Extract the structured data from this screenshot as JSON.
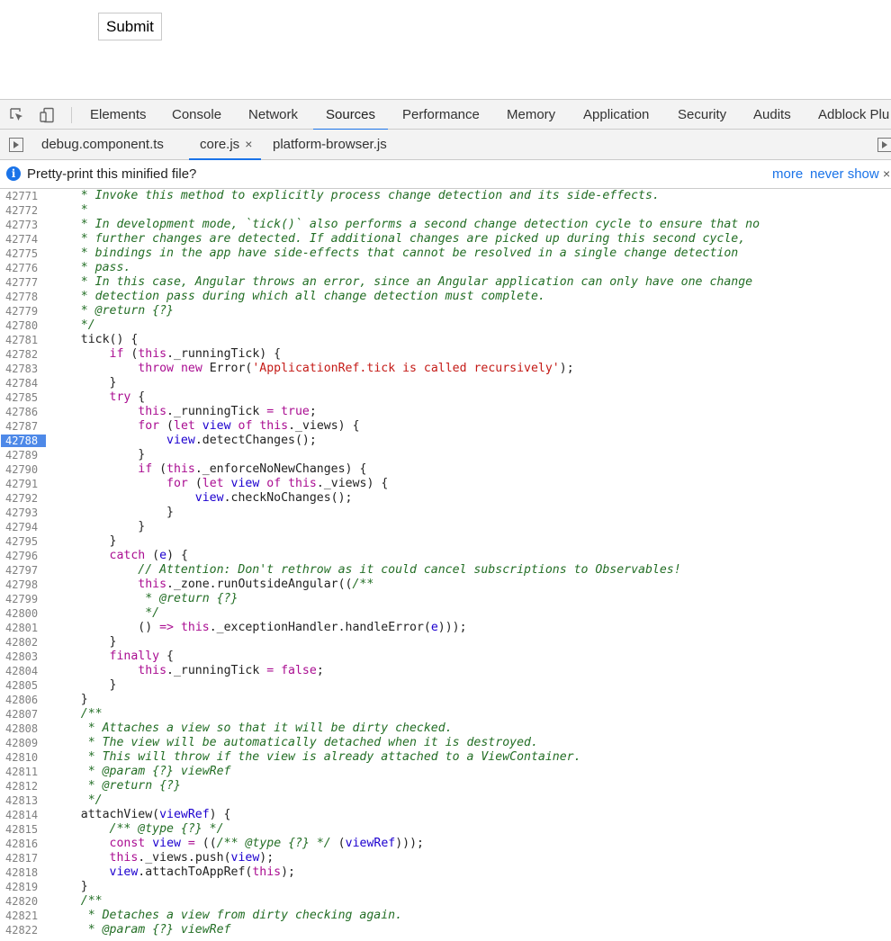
{
  "page": {
    "submit_label": "Submit"
  },
  "devtools": {
    "panel_tabs": [
      {
        "label": "Elements"
      },
      {
        "label": "Console"
      },
      {
        "label": "Network"
      },
      {
        "label": "Sources",
        "active": true
      },
      {
        "label": "Performance"
      },
      {
        "label": "Memory"
      },
      {
        "label": "Application"
      },
      {
        "label": "Security"
      },
      {
        "label": "Audits"
      },
      {
        "label": "Adblock Plu"
      }
    ],
    "file_tabs": [
      {
        "label": "debug.component.ts"
      },
      {
        "label": "core.js",
        "active": true,
        "closable": true
      },
      {
        "label": "platform-browser.js"
      }
    ],
    "close_glyph": "×",
    "infobar": {
      "message": "Pretty-print this minified file?",
      "more": "more",
      "never_show": "never show",
      "close": "×"
    },
    "breakpoint_line": "42788",
    "code_lines": [
      {
        "n": "42771",
        "t": "    * Invoke this method to explicitly process change detection and its side-effects."
      },
      {
        "n": "42772",
        "t": "    *"
      },
      {
        "n": "42773",
        "t": "    * In development mode, `tick()` also performs a second change detection cycle to ensure that no"
      },
      {
        "n": "42774",
        "t": "    * further changes are detected. If additional changes are picked up during this second cycle,"
      },
      {
        "n": "42775",
        "t": "    * bindings in the app have side-effects that cannot be resolved in a single change detection"
      },
      {
        "n": "42776",
        "t": "    * pass."
      },
      {
        "n": "42777",
        "t": "    * In this case, Angular throws an error, since an Angular application can only have one change"
      },
      {
        "n": "42778",
        "t": "    * detection pass during which all change detection must complete."
      },
      {
        "n": "42779",
        "t": "    * @return {?}"
      },
      {
        "n": "42780",
        "t": "    */"
      },
      {
        "n": "42781",
        "t": "    tick() {"
      },
      {
        "n": "42782",
        "t": "        if (this._runningTick) {"
      },
      {
        "n": "42783",
        "t": "            throw new Error('ApplicationRef.tick is called recursively');"
      },
      {
        "n": "42784",
        "t": "        }"
      },
      {
        "n": "42785",
        "t": "        try {"
      },
      {
        "n": "42786",
        "t": "            this._runningTick = true;"
      },
      {
        "n": "42787",
        "t": "            for (let view of this._views) {"
      },
      {
        "n": "42788",
        "t": "                view.detectChanges();"
      },
      {
        "n": "42789",
        "t": "            }"
      },
      {
        "n": "42790",
        "t": "            if (this._enforceNoNewChanges) {"
      },
      {
        "n": "42791",
        "t": "                for (let view of this._views) {"
      },
      {
        "n": "42792",
        "t": "                    view.checkNoChanges();"
      },
      {
        "n": "42793",
        "t": "                }"
      },
      {
        "n": "42794",
        "t": "            }"
      },
      {
        "n": "42795",
        "t": "        }"
      },
      {
        "n": "42796",
        "t": "        catch (e) {"
      },
      {
        "n": "42797",
        "t": "            // Attention: Don't rethrow as it could cancel subscriptions to Observables!"
      },
      {
        "n": "42798",
        "t": "            this._zone.runOutsideAngular((/**"
      },
      {
        "n": "42799",
        "t": "             * @return {?}"
      },
      {
        "n": "42800",
        "t": "             */"
      },
      {
        "n": "42801",
        "t": "            () => this._exceptionHandler.handleError(e)));"
      },
      {
        "n": "42802",
        "t": "        }"
      },
      {
        "n": "42803",
        "t": "        finally {"
      },
      {
        "n": "42804",
        "t": "            this._runningTick = false;"
      },
      {
        "n": "42805",
        "t": "        }"
      },
      {
        "n": "42806",
        "t": "    }"
      },
      {
        "n": "42807",
        "t": "    /**"
      },
      {
        "n": "42808",
        "t": "     * Attaches a view so that it will be dirty checked."
      },
      {
        "n": "42809",
        "t": "     * The view will be automatically detached when it is destroyed."
      },
      {
        "n": "42810",
        "t": "     * This will throw if the view is already attached to a ViewContainer."
      },
      {
        "n": "42811",
        "t": "     * @param {?} viewRef"
      },
      {
        "n": "42812",
        "t": "     * @return {?}"
      },
      {
        "n": "42813",
        "t": "     */"
      },
      {
        "n": "42814",
        "t": "    attachView(viewRef) {"
      },
      {
        "n": "42815",
        "t": "        /** @type {?} */"
      },
      {
        "n": "42816",
        "t": "        const view = ((/** @type {?} */ (viewRef)));"
      },
      {
        "n": "42817",
        "t": "        this._views.push(view);"
      },
      {
        "n": "42818",
        "t": "        view.attachToAppRef(this);"
      },
      {
        "n": "42819",
        "t": "    }"
      },
      {
        "n": "42820",
        "t": "    /**"
      },
      {
        "n": "42821",
        "t": "     * Detaches a view from dirty checking again."
      },
      {
        "n": "42822",
        "t": "     * @param {?} viewRef"
      }
    ]
  }
}
